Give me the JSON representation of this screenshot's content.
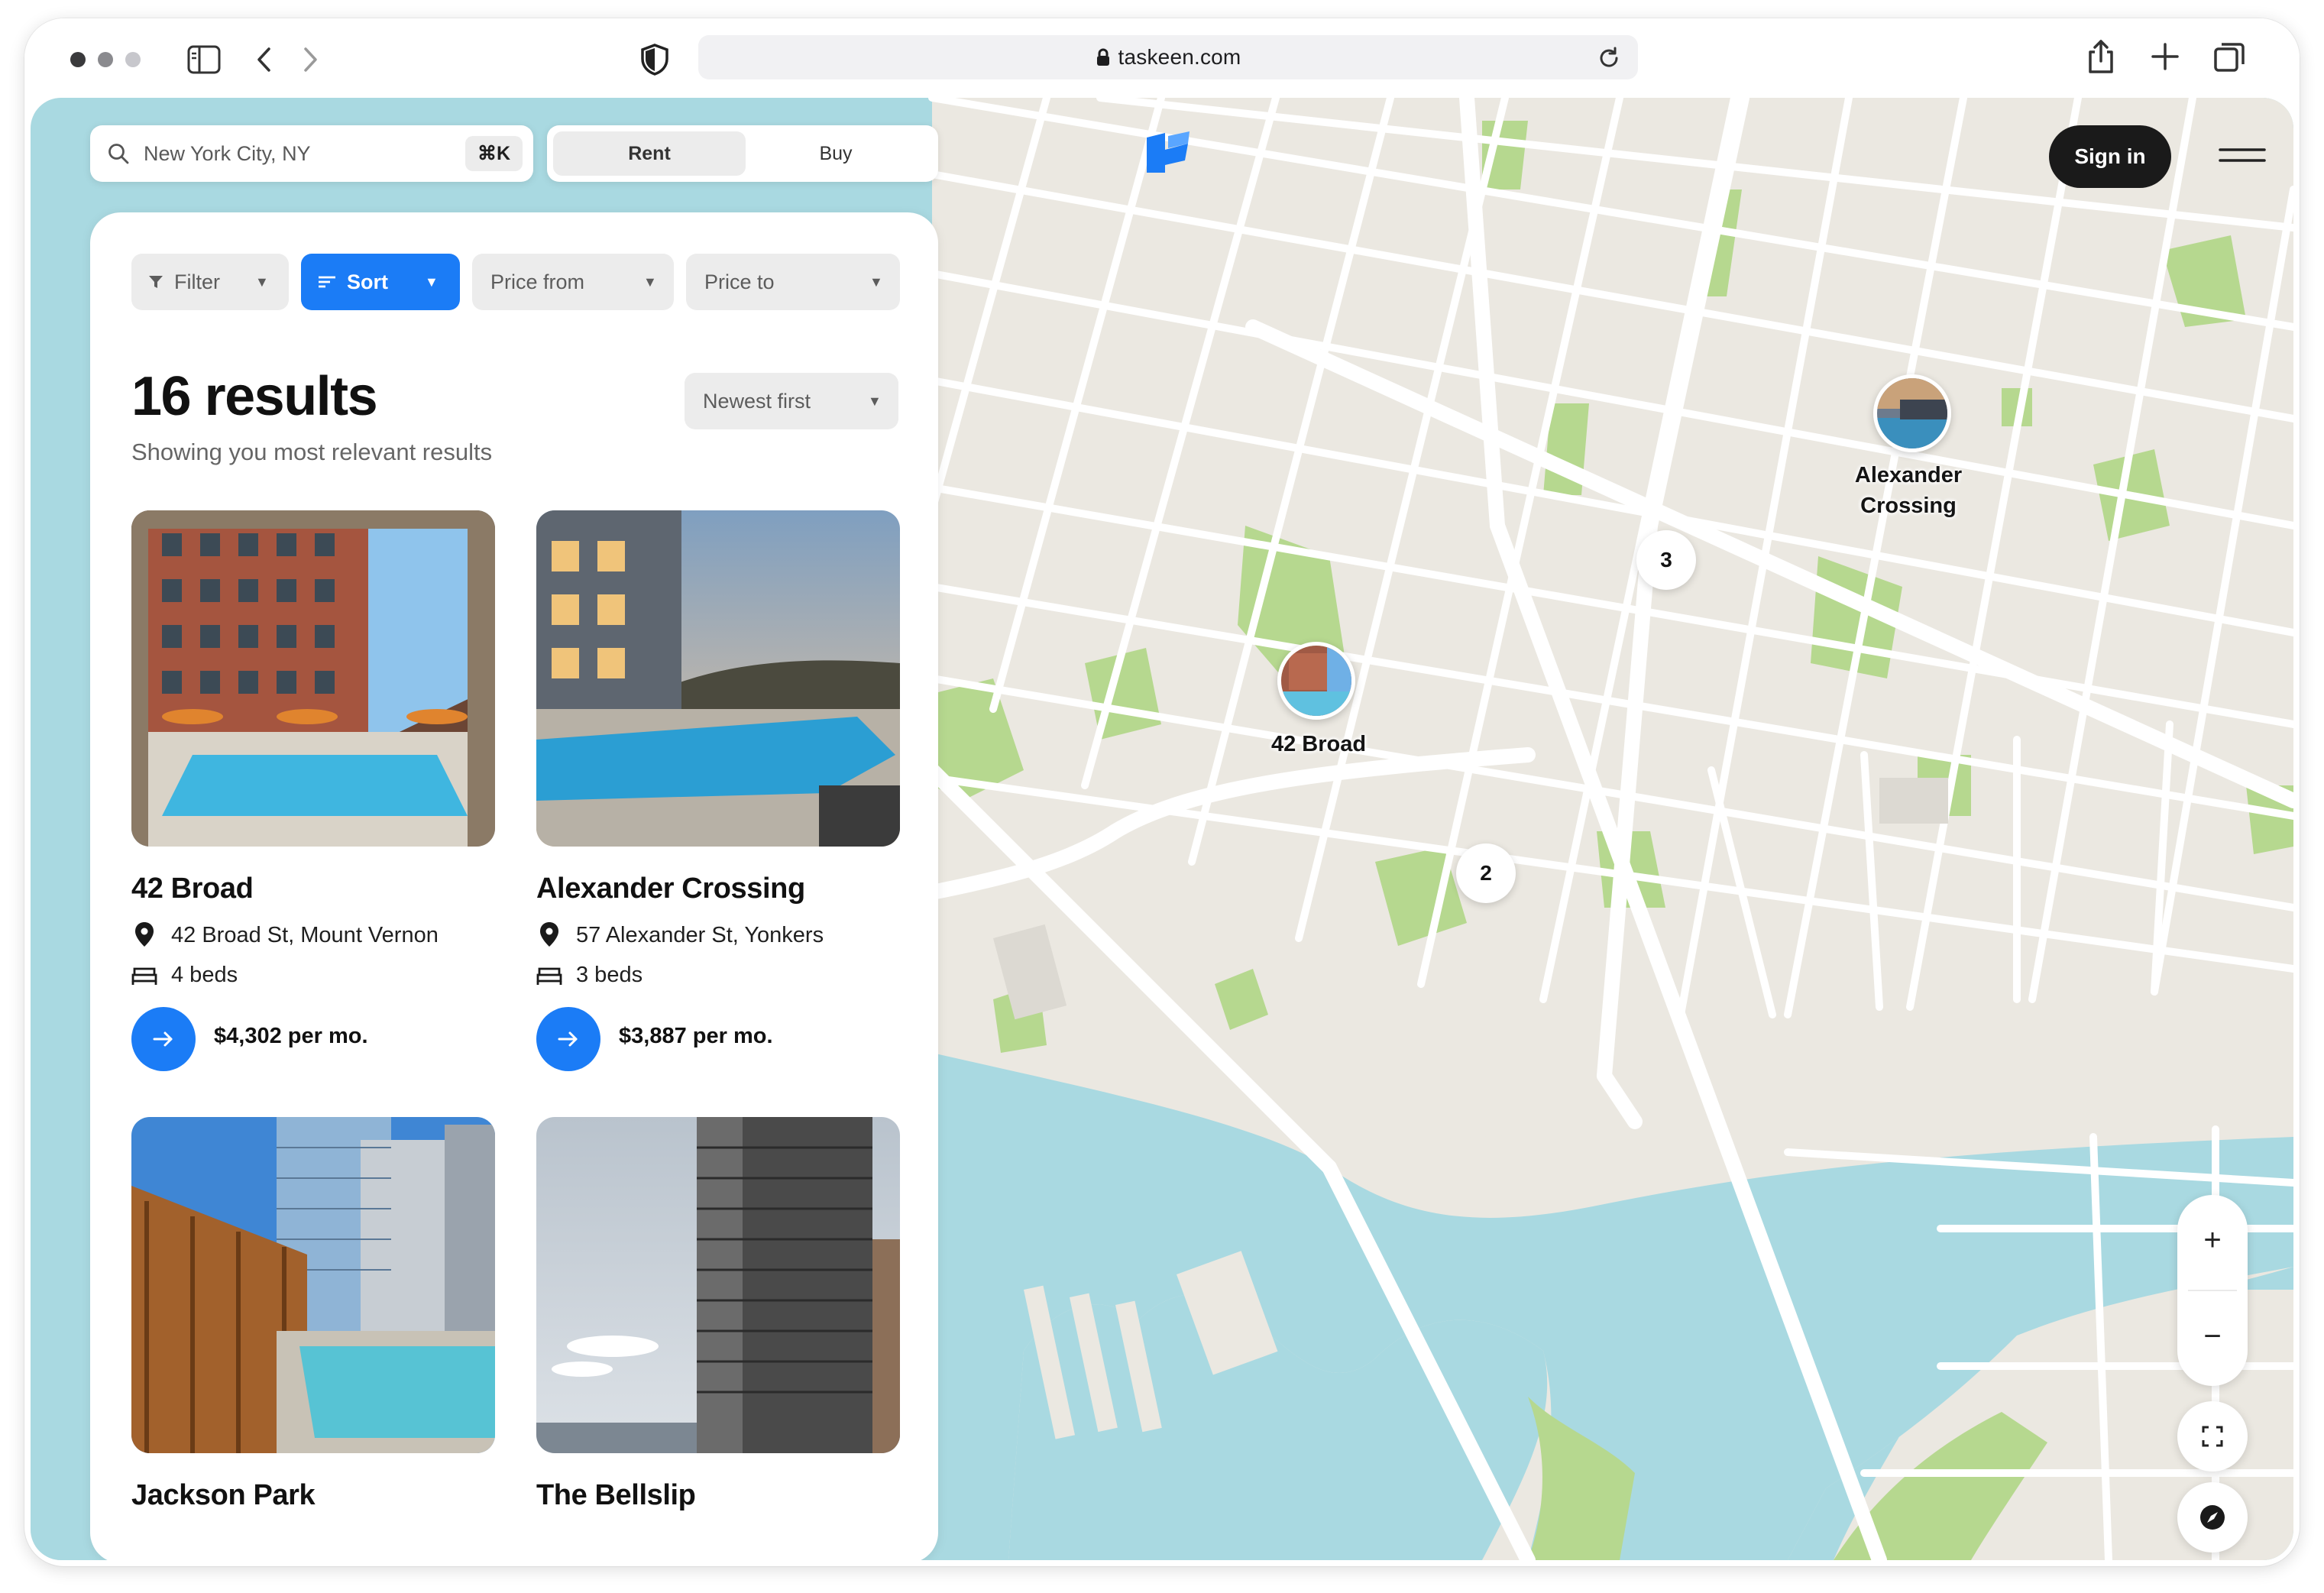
{
  "browser": {
    "url": "taskeen.com"
  },
  "search": {
    "placeholder": "New York City, NY",
    "shortcut": "⌘K"
  },
  "mode_toggle": {
    "options": [
      "Rent",
      "Buy"
    ],
    "selected": "Rent"
  },
  "filters": {
    "filter_label": "Filter",
    "sort_label": "Sort",
    "price_from_label": "Price from",
    "price_to_label": "Price to"
  },
  "results": {
    "title": "16 results",
    "subtitle": "Showing you most relevant results",
    "sort_value": "Newest first"
  },
  "listings": [
    {
      "name": "42 Broad",
      "address": "42 Broad St, Mount Vernon",
      "beds": "4 beds",
      "price": "$4,302 per mo."
    },
    {
      "name": "Alexander Crossing",
      "address": "57 Alexander St, Yonkers",
      "beds": "3 beds",
      "price": "$3,887 per mo."
    },
    {
      "name": "Jackson Park"
    },
    {
      "name": "The Bellslip"
    }
  ],
  "header": {
    "sign_in_label": "Sign in"
  },
  "map": {
    "markers": [
      {
        "label": "42 Broad"
      },
      {
        "label": "Alexander Crossing"
      }
    ],
    "clusters": [
      "3",
      "2"
    ],
    "controls": {
      "zoom_in": "+",
      "zoom_out": "−"
    }
  },
  "colors": {
    "accent": "#1b7cf6",
    "water": "#a9d9e1",
    "park": "#b6d88f",
    "land": "#ebe8e1",
    "road": "#ffffff",
    "dark_button": "#1a1a1a"
  },
  "icons": [
    "sidebar-icon",
    "back-icon",
    "forward-icon",
    "shield-icon",
    "lock-icon",
    "reload-icon",
    "share-icon",
    "new-tab-icon",
    "tabs-icon",
    "search-icon",
    "filter-icon",
    "sort-icon",
    "chevron-down-icon",
    "location-pin-icon",
    "bed-icon",
    "arrow-right-icon",
    "menu-icon",
    "fullscreen-icon",
    "compass-icon"
  ]
}
